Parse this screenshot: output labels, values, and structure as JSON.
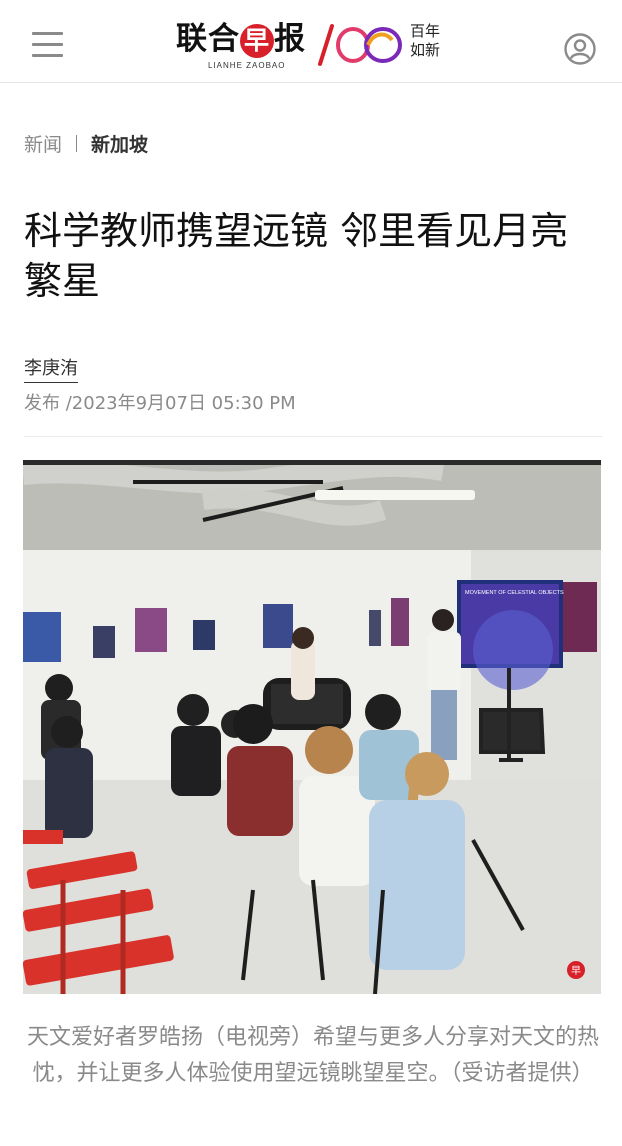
{
  "header": {
    "logo_text_a": "联合",
    "logo_text_red": "早",
    "logo_text_b": "报",
    "logo_subtitle": "LIANHE ZAOBAO",
    "logo_100": "100",
    "logo_tagline_1": "百年",
    "logo_tagline_2": "如新",
    "menu_icon": "hamburger-menu-icon",
    "user_icon": "user-profile-icon"
  },
  "breadcrumb": {
    "section": "新闻",
    "subsection": "新加坡"
  },
  "article": {
    "title": "科学教师携望远镜 邻里看见月亮繁星",
    "author": "李庚洧",
    "published": "发布 /2023年9月07日 05:30 PM",
    "photo_caption": "天文爱好者罗皓扬（电视旁）希望与更多人分享对天文的热忱，并让更多人体验使用望远镜眺望星空。（受访者提供）",
    "screen_text": "MOVEMENT OF CELESTIAL OBJECTS",
    "photo_watermark": "早"
  },
  "colors": {
    "brand_red": "#d8202a",
    "muted_text": "#8a8a8a",
    "chair_red": "#d8322a"
  }
}
